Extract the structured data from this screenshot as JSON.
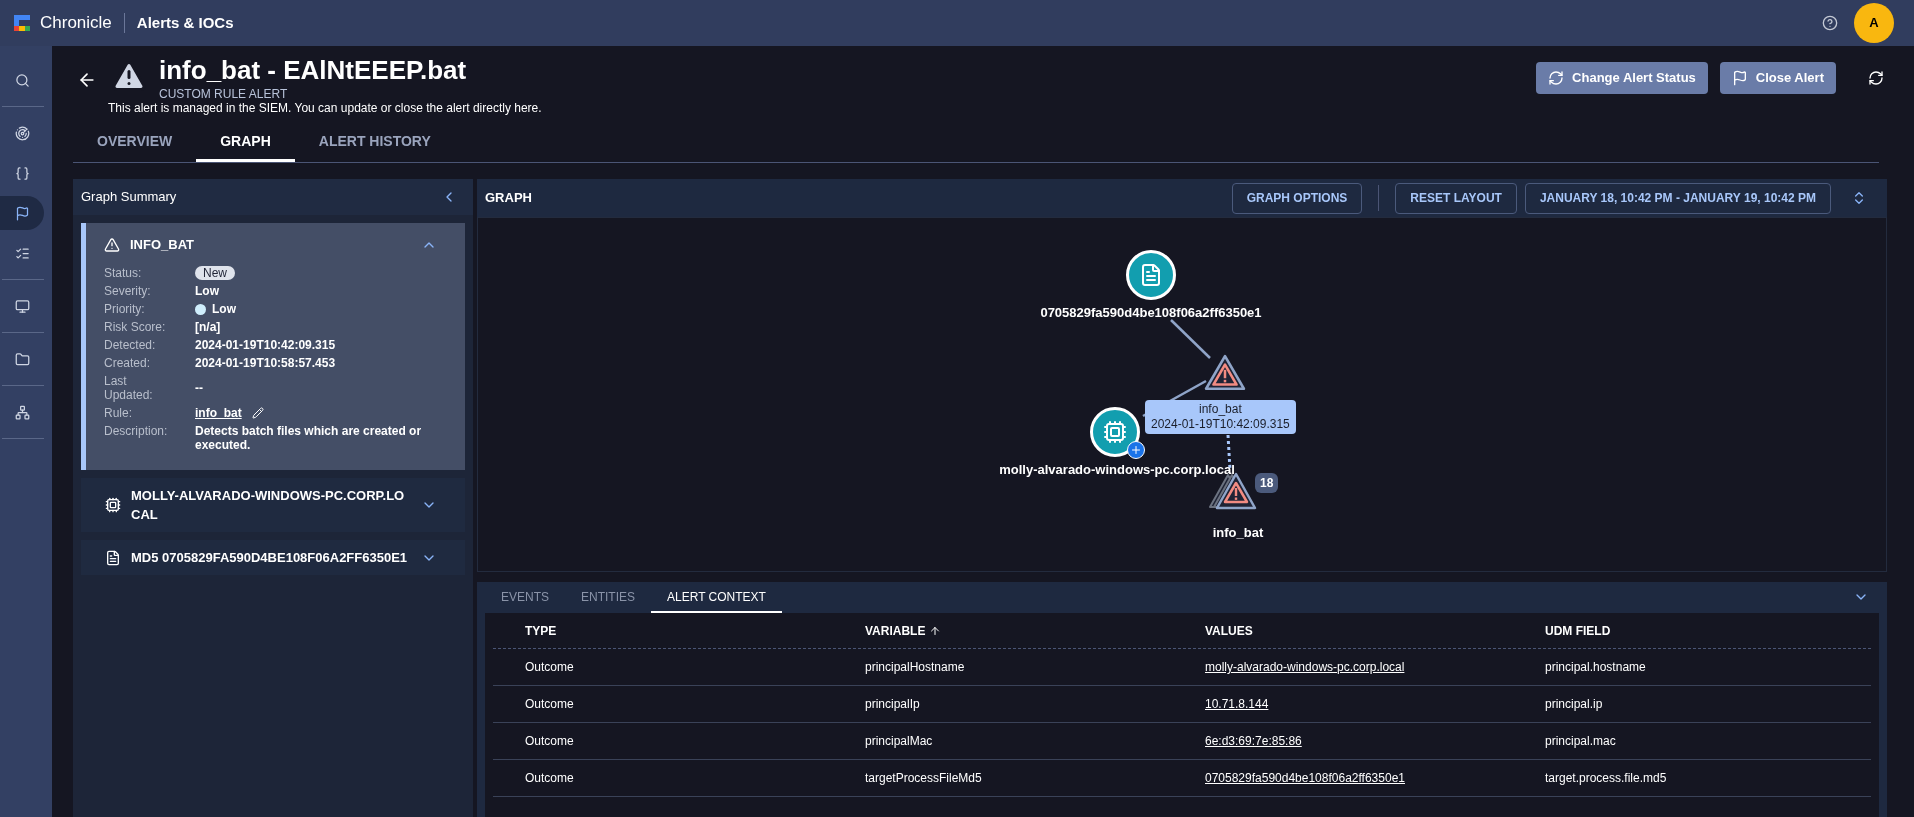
{
  "topbar": {
    "product": "Chronicle",
    "section": "Alerts & IOCs",
    "avatar": "A"
  },
  "nav": [
    {
      "kind": "search",
      "selected": false
    },
    {
      "kind": "radar",
      "selected": false
    },
    {
      "kind": "braces",
      "selected": false
    },
    {
      "kind": "flag",
      "selected": true
    },
    {
      "kind": "list",
      "selected": false
    },
    {
      "kind": "monitor",
      "selected": false
    },
    {
      "kind": "folder",
      "selected": false
    },
    {
      "kind": "tree",
      "selected": false
    }
  ],
  "header": {
    "title": "info_bat - EAlNtEEEP.bat",
    "subtitle": "CUSTOM RULE ALERT",
    "description": "This alert is managed in the SIEM. You can update or close the alert directly here.",
    "buttons": [
      {
        "kind": "status",
        "label": "Change Alert Status"
      },
      {
        "kind": "close",
        "label": "Close Alert"
      }
    ]
  },
  "tabs": [
    {
      "label": "OVERVIEW",
      "selected": false
    },
    {
      "label": "GRAPH",
      "selected": true
    },
    {
      "label": "ALERT HISTORY",
      "selected": false
    }
  ],
  "summary": {
    "title": "Graph Summary",
    "sections": [
      {
        "kind": "alert",
        "title": "INFO_BAT",
        "expanded": true,
        "fields": [
          {
            "kind": "badge",
            "label": "Status:",
            "value": "New"
          },
          {
            "kind": "text",
            "label": "Severity:",
            "value": "Low"
          },
          {
            "kind": "dot",
            "label": "Priority:",
            "value": "Low"
          },
          {
            "kind": "text",
            "label": "Risk Score:",
            "value": "[n/a]"
          },
          {
            "kind": "text",
            "label": "Detected:",
            "value": "2024-01-19T10:42:09.315"
          },
          {
            "kind": "text",
            "label": "Created:",
            "value": "2024-01-19T10:58:57.453"
          },
          {
            "kind": "text",
            "label": "Last Updated:",
            "value": "--"
          },
          {
            "kind": "link",
            "label": "Rule:",
            "value": "info_bat"
          },
          {
            "kind": "text",
            "label": "Description:",
            "value": "Detects batch files which are created or executed."
          }
        ]
      },
      {
        "kind": "host",
        "title": "MOLLY-ALVARADO-WINDOWS-PC.CORP.LOCAL",
        "expanded": false
      },
      {
        "kind": "file",
        "title": "MD5 0705829FA590D4BE108F06A2FF6350E1",
        "expanded": false
      }
    ]
  },
  "graph": {
    "title": "GRAPH",
    "buttons": [
      "GRAPH OPTIONS",
      "RESET LAYOUT",
      "JANUARY 18, 10:42 PM - JANUARY 19, 10:42 PM"
    ],
    "nodes": [
      {
        "kind": "file",
        "label": "0705829fa590d4be108f06a2ff6350e1"
      },
      {
        "kind": "alert",
        "tooltip_title": "info_bat",
        "tooltip_time": "2024-01-19T10:42:09.315"
      },
      {
        "kind": "host",
        "label": "molly-alvarado-windows-pc.corp.local"
      },
      {
        "kind": "alert_group",
        "label": "info_bat",
        "count": "18"
      }
    ]
  },
  "details": {
    "tabs": [
      {
        "label": "EVENTS",
        "selected": false
      },
      {
        "label": "ENTITIES",
        "selected": false
      },
      {
        "label": "ALERT CONTEXT",
        "selected": true
      }
    ],
    "columns": [
      {
        "label": "TYPE",
        "sorted": false
      },
      {
        "label": "VARIABLE",
        "sorted": true
      },
      {
        "label": "VALUES",
        "sorted": false
      },
      {
        "label": "UDM FIELD",
        "sorted": false
      }
    ],
    "rows": [
      [
        "Outcome",
        "principalHostname",
        "molly-alvarado-windows-pc.corp.local",
        "principal.hostname"
      ],
      [
        "Outcome",
        "principalIp",
        "10.71.8.144",
        "principal.ip"
      ],
      [
        "Outcome",
        "principalMac",
        "6e:d3:69:7e:85:86",
        "principal.mac"
      ],
      [
        "Outcome",
        "targetProcessFileMd5",
        "0705829fa590d4be108f06a2ff6350e1",
        "target.process.file.md5"
      ]
    ]
  }
}
